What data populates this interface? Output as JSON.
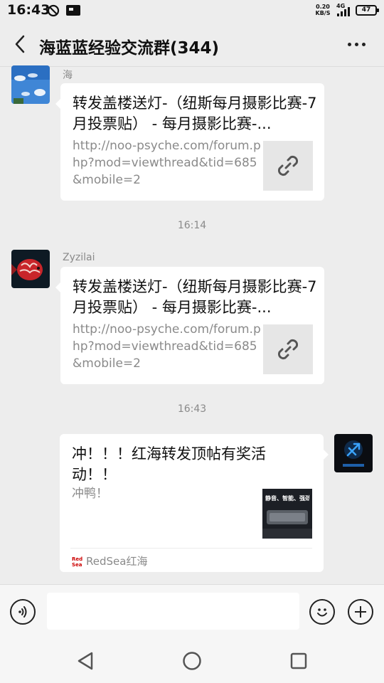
{
  "status_bar": {
    "time": "16:43",
    "net_speed_value": "0.20",
    "net_speed_unit": "KB/S",
    "network": "4G",
    "battery": "47"
  },
  "header": {
    "title": "海蓝蓝经验交流群(344)",
    "back_icon": "chevron-left-icon",
    "more_icon": "more-dots-icon"
  },
  "messages": [
    {
      "sender": "海",
      "title": "转发盖楼送灯-（纽斯每月摄影比赛-7月投票贴） - 每月摄影比赛-...",
      "desc": "http://noo-psyche.com/forum.php?mod=viewthread&tid=685&mobile=2"
    },
    {
      "timestamp": "16:14",
      "sender": "Zyzilai",
      "title": "转发盖楼送灯-（纽斯每月摄影比赛-7月投票贴） - 每月摄影比赛-...",
      "desc": "http://noo-psyche.com/forum.php?mod=viewthread&tid=685&mobile=2"
    },
    {
      "timestamp": "16:43",
      "title": "冲！！！红海转发顶帖有奖活动！！",
      "desc": "冲鸭！",
      "thumb_text": "静音、智能、强劲",
      "source_logo": "Red Sea",
      "source": "RedSea红海"
    }
  ],
  "input_bar": {
    "voice_icon": "voice-icon",
    "emoji_icon": "emoji-icon",
    "plus_icon": "plus-icon",
    "placeholder": ""
  },
  "colors": {
    "background": "#ededed",
    "bubble": "#ffffff",
    "muted_text": "#8a8a8a"
  }
}
